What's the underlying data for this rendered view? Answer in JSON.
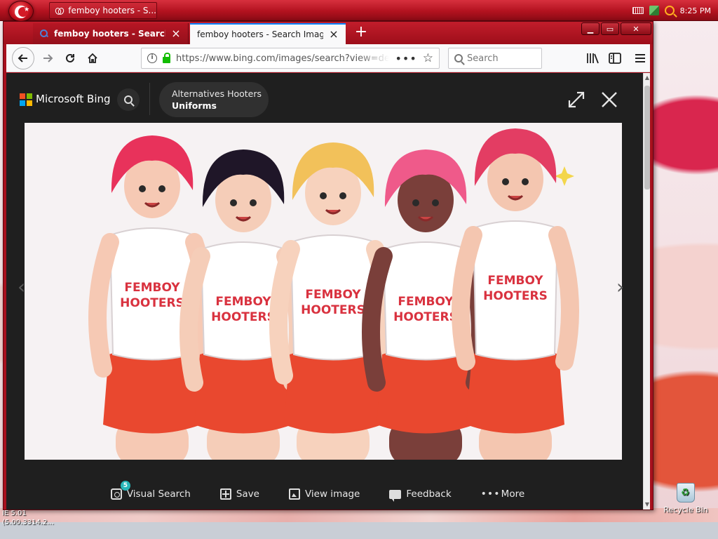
{
  "taskbar": {
    "window_button_label": "femboy hooters - S...",
    "clock": "8:25 PM"
  },
  "browser": {
    "tabs": [
      {
        "label": "femboy hooters - Search",
        "active": false
      },
      {
        "label": "femboy hooters - Search Images",
        "active": true
      }
    ],
    "new_tab_label": "+",
    "window_controls": {
      "minimize": "▁",
      "maximize": "▭",
      "close": "✕"
    },
    "url": "https://www.bing.com/images/search?view=de",
    "search_placeholder": "Search"
  },
  "bing": {
    "brand": "Microsoft Bing",
    "pill_line1": "Alternatives Hooters",
    "pill_line2": "Uniforms"
  },
  "image": {
    "shirt_text_line1": "FEMBOY",
    "shirt_text_line2": "HOOTERS",
    "character_colors": [
      "#e8325b",
      "#1f1628",
      "#f2c15a",
      "#ef5a8a",
      "#e33d63"
    ],
    "shorts_color": "#e9482f"
  },
  "actions": [
    {
      "label": "Visual Search",
      "badge": "5"
    },
    {
      "label": "Save"
    },
    {
      "label": "View image"
    },
    {
      "label": "Feedback"
    },
    {
      "label": "More"
    }
  ],
  "desktop": {
    "ie_version_line1": "IE 5.01",
    "ie_version_line2": "(5.00.3314.2...",
    "recycle_bin_label": "Recycle Bin"
  }
}
